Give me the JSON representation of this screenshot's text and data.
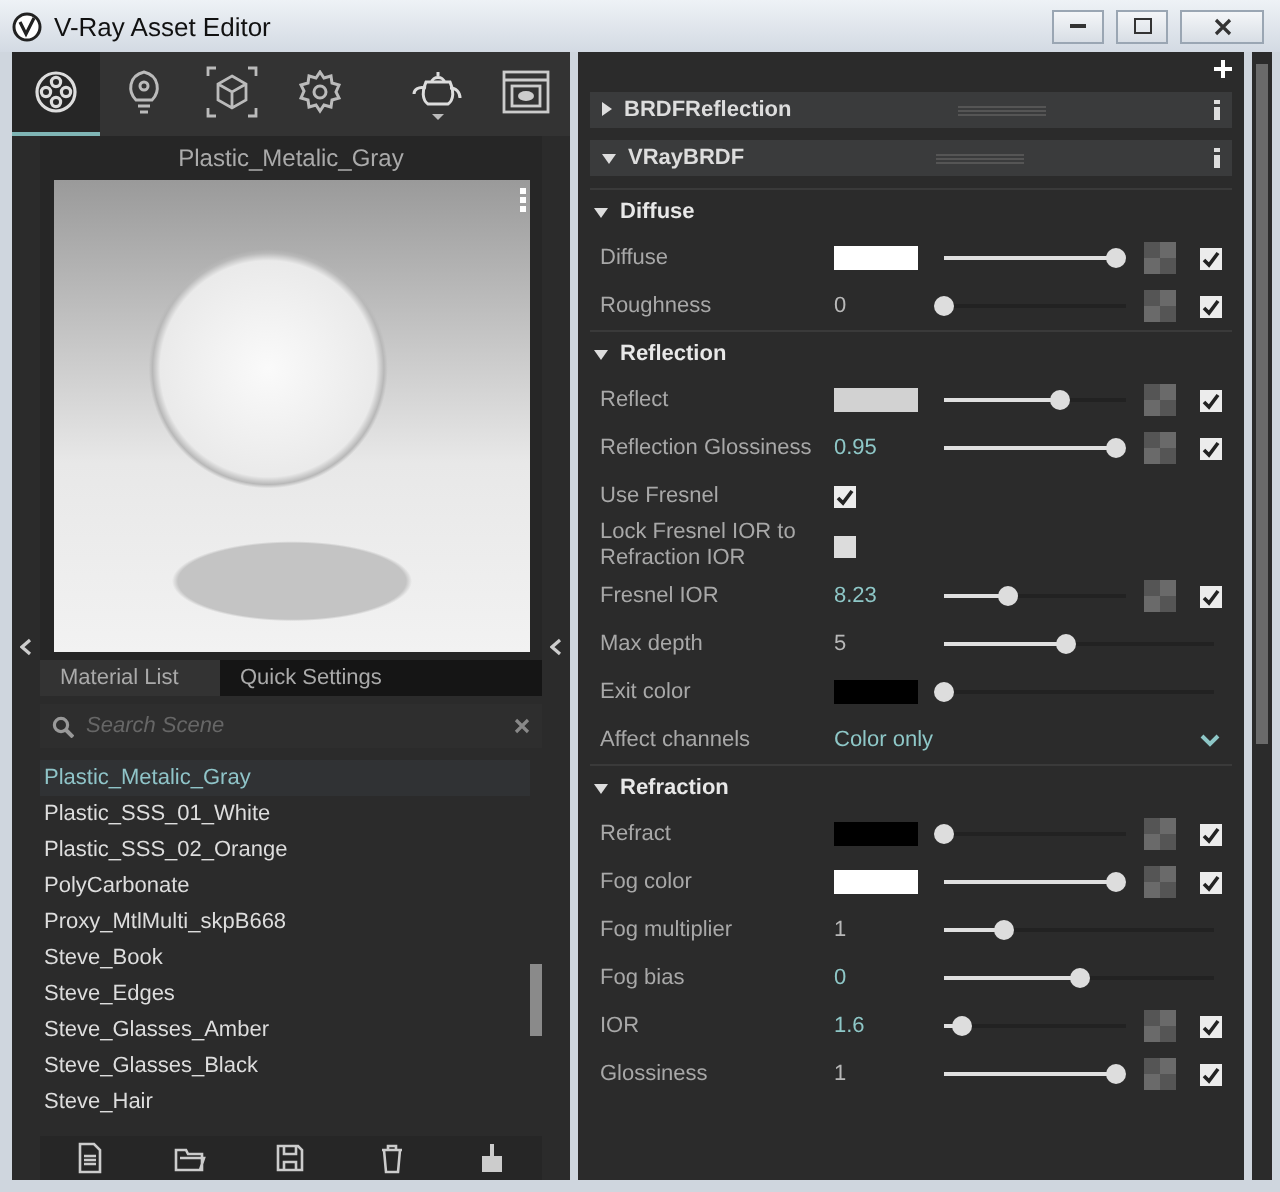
{
  "window": {
    "title": "V-Ray Asset Editor"
  },
  "toolbar": [
    {
      "kind": "materials",
      "selected": true
    },
    {
      "kind": "lights",
      "selected": false
    },
    {
      "kind": "geometry",
      "selected": false
    },
    {
      "kind": "settings",
      "selected": false
    },
    {
      "kind": "render",
      "selected": false
    },
    {
      "kind": "frame_buffer",
      "selected": false
    }
  ],
  "preview": {
    "title": "Plastic_Metalic_Gray"
  },
  "list_tabs": [
    {
      "label": "Material List",
      "selected": true
    },
    {
      "label": "Quick Settings",
      "selected": false
    }
  ],
  "search": {
    "placeholder": "Search Scene"
  },
  "materials": [
    {
      "name": "Plastic_Metalic_Gray",
      "selected": true
    },
    {
      "name": "Plastic_SSS_01_White",
      "selected": false
    },
    {
      "name": "Plastic_SSS_02_Orange",
      "selected": false
    },
    {
      "name": "PolyCarbonate",
      "selected": false
    },
    {
      "name": "Proxy_MtlMulti_skpB668",
      "selected": false
    },
    {
      "name": "Steve_Book",
      "selected": false
    },
    {
      "name": "Steve_Edges",
      "selected": false
    },
    {
      "name": "Steve_Glasses_Amber",
      "selected": false
    },
    {
      "name": "Steve_Glasses_Black",
      "selected": false
    },
    {
      "name": "Steve_Hair",
      "selected": false
    }
  ],
  "layers": [
    {
      "name": "BRDFReflection",
      "expanded": false
    },
    {
      "name": "VRayBRDF",
      "expanded": true
    }
  ],
  "sections": [
    {
      "title": "Diffuse",
      "expanded": true,
      "params": [
        {
          "kind": "color",
          "label": "Diffuse",
          "color": "#ffffff",
          "level": 0.95,
          "enabled": true
        },
        {
          "kind": "number",
          "label": "Roughness",
          "value": "0",
          "changed": false,
          "level": 0,
          "enabled": true
        }
      ]
    },
    {
      "title": "Reflection",
      "expanded": true,
      "params": [
        {
          "kind": "color",
          "label": "Reflect",
          "color": "#d2d2d2",
          "level": 0.64,
          "enabled": true
        },
        {
          "kind": "number",
          "label": "Reflection Glossiness",
          "value": "0.95",
          "changed": true,
          "level": 0.95,
          "enabled": true
        },
        {
          "kind": "toggle",
          "label": "Use Fresnel",
          "checked": true
        },
        {
          "kind": "toggle",
          "label": "Lock Fresnel IOR to Refraction IOR",
          "checked": false
        },
        {
          "kind": "number",
          "label": "Fresnel IOR",
          "value": "8.23",
          "changed": true,
          "level": 0.35,
          "enabled": true
        },
        {
          "kind": "number",
          "label": "Max depth",
          "value": "5",
          "changed": false,
          "level": 0.45
        },
        {
          "kind": "color",
          "label": "Exit color",
          "color": "#000000",
          "level": 0
        },
        {
          "kind": "dropdown",
          "label": "Affect channels",
          "value": "Color only"
        }
      ]
    },
    {
      "title": "Refraction",
      "expanded": true,
      "params": [
        {
          "kind": "color",
          "label": "Refract",
          "color": "#000000",
          "level": 0,
          "enabled": true
        },
        {
          "kind": "color",
          "label": "Fog color",
          "color": "#ffffff",
          "level": 0.95,
          "enabled": true
        },
        {
          "kind": "number",
          "label": "Fog multiplier",
          "value": "1",
          "changed": false,
          "level": 0.22
        },
        {
          "kind": "number",
          "label": "Fog bias",
          "value": "0",
          "changed": true,
          "level": 0.5
        },
        {
          "kind": "number",
          "label": "IOR",
          "value": "1.6",
          "changed": true,
          "level": 0.1,
          "enabled": true
        },
        {
          "kind": "number",
          "label": "Glossiness",
          "value": "1",
          "changed": false,
          "level": 0.95,
          "enabled": true
        }
      ]
    }
  ]
}
